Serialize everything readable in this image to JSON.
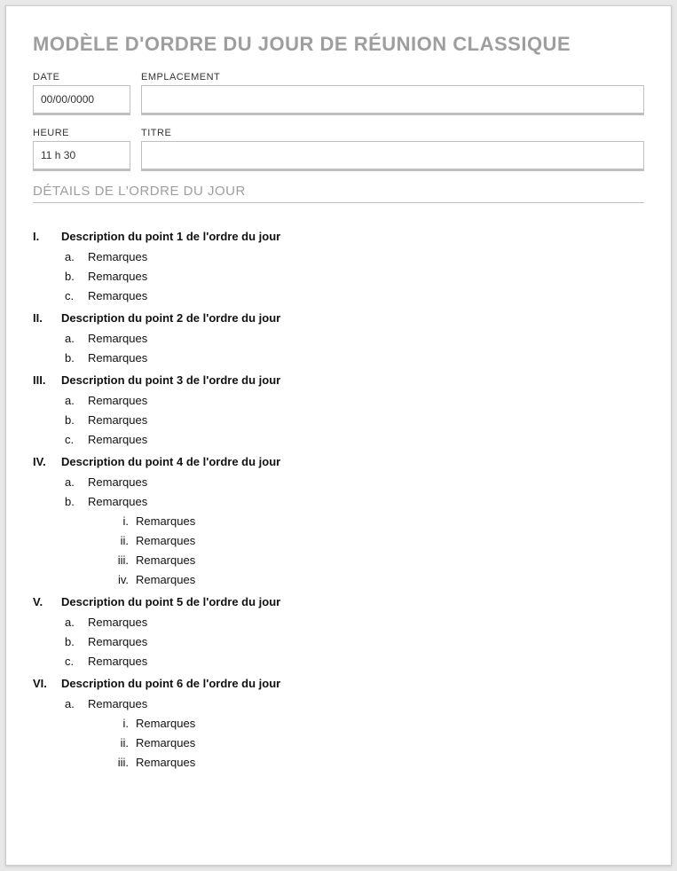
{
  "title": "MODÈLE D'ORDRE DU JOUR DE RÉUNION CLASSIQUE",
  "fields": {
    "date": {
      "label": "DATE",
      "value": "00/00/0000"
    },
    "location": {
      "label": "EMPLACEMENT",
      "value": ""
    },
    "time": {
      "label": "HEURE",
      "value": "11 h 30"
    },
    "subject": {
      "label": "TITRE",
      "value": ""
    }
  },
  "section_header": "DÉTAILS DE L'ORDRE DU JOUR",
  "agenda": [
    {
      "num": "I.",
      "title": "Description du point 1 de l'ordre du jour",
      "subs": [
        {
          "letter": "a.",
          "text": "Remarques"
        },
        {
          "letter": "b.",
          "text": "Remarques"
        },
        {
          "letter": "c.",
          "text": "Remarques"
        }
      ]
    },
    {
      "num": "II.",
      "title": "Description du point 2 de l'ordre du jour",
      "subs": [
        {
          "letter": "a.",
          "text": "Remarques"
        },
        {
          "letter": "b.",
          "text": "Remarques"
        }
      ]
    },
    {
      "num": "III.",
      "title": "Description du point 3 de l'ordre du jour",
      "subs": [
        {
          "letter": "a.",
          "text": "Remarques"
        },
        {
          "letter": "b.",
          "text": "Remarques"
        },
        {
          "letter": "c.",
          "text": "Remarques"
        }
      ]
    },
    {
      "num": "IV.",
      "title": "Description du point 4 de l'ordre du jour",
      "subs": [
        {
          "letter": "a.",
          "text": "Remarques"
        },
        {
          "letter": "b.",
          "text": "Remarques",
          "subsubs": [
            {
              "rn": "i.",
              "text": "Remarques"
            },
            {
              "rn": "ii.",
              "text": "Remarques"
            },
            {
              "rn": "iii.",
              "text": "Remarques"
            },
            {
              "rn": "iv.",
              "text": "Remarques"
            }
          ]
        }
      ]
    },
    {
      "num": "V.",
      "title": "Description du point 5 de l'ordre du jour",
      "subs": [
        {
          "letter": "a.",
          "text": "Remarques"
        },
        {
          "letter": "b.",
          "text": "Remarques"
        },
        {
          "letter": "c.",
          "text": "Remarques"
        }
      ]
    },
    {
      "num": "VI.",
      "title": "Description du point 6 de l'ordre du jour",
      "subs": [
        {
          "letter": "a.",
          "text": "Remarques",
          "subsubs": [
            {
              "rn": "i.",
              "text": "Remarques"
            },
            {
              "rn": "ii.",
              "text": "Remarques"
            },
            {
              "rn": "iii.",
              "text": "Remarques"
            }
          ]
        }
      ]
    }
  ]
}
